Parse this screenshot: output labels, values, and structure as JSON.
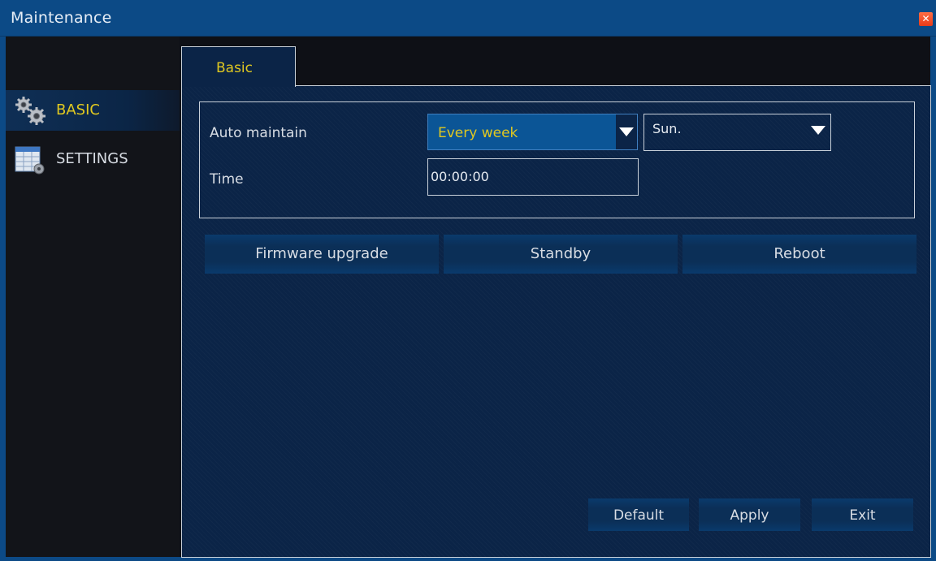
{
  "window": {
    "title": "Maintenance"
  },
  "sidebar": {
    "items": [
      {
        "label": "BASIC",
        "icon": "gears-icon",
        "active": true
      },
      {
        "label": "SETTINGS",
        "icon": "settings-table-icon",
        "active": false
      }
    ]
  },
  "tabs": [
    {
      "label": "Basic",
      "active": true
    }
  ],
  "form": {
    "auto_maintain_label": "Auto maintain",
    "auto_maintain_value": "Every week",
    "day_value": "Sun.",
    "time_label": "Time",
    "time_value": "00:00:00"
  },
  "actions": {
    "firmware_upgrade": "Firmware upgrade",
    "standby": "Standby",
    "reboot": "Reboot"
  },
  "footer": {
    "default": "Default",
    "apply": "Apply",
    "exit": "Exit"
  },
  "colors": {
    "titlebar": "#0c4a86",
    "panel": "#0b2447",
    "accent_text": "#e0c820",
    "close": "#e83a18"
  }
}
